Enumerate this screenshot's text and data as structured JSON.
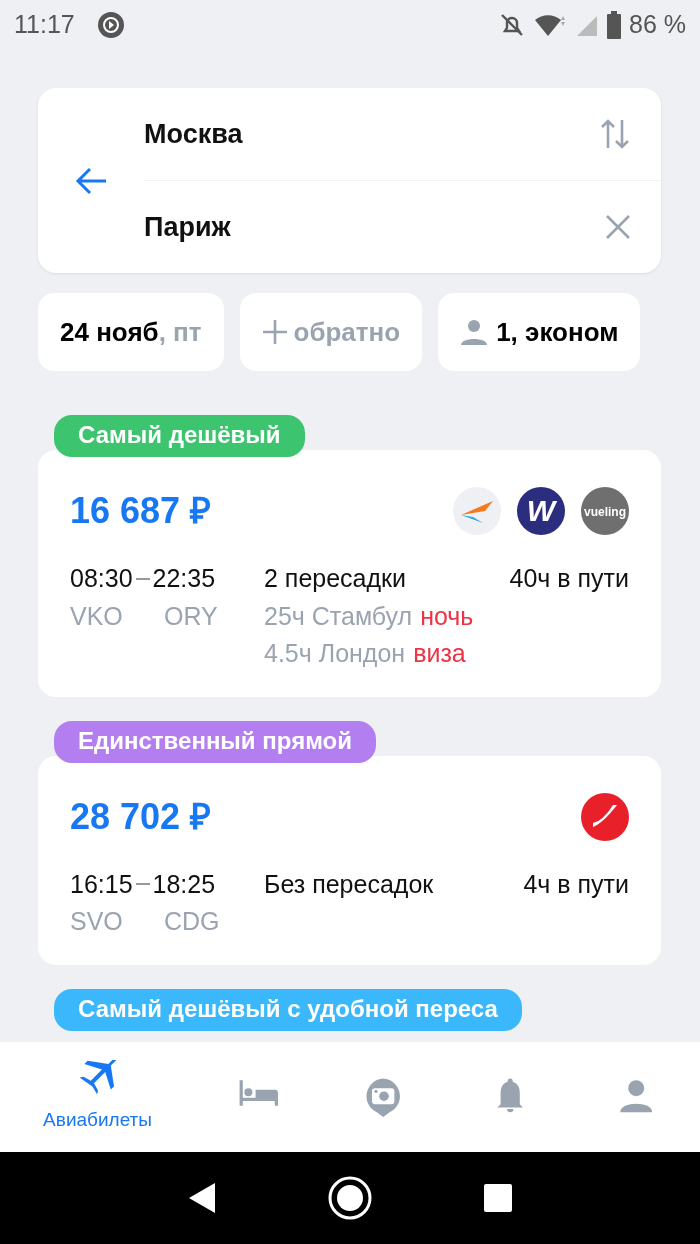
{
  "status_bar": {
    "time": "11:17",
    "battery": "86 %"
  },
  "search": {
    "from": "Москва",
    "to": "Париж"
  },
  "chips": [
    {
      "kind": "date",
      "text": "24 нояб",
      "suffix": ", пт"
    },
    {
      "kind": "return",
      "text": "обратно"
    },
    {
      "kind": "passengers",
      "text": "1, эконом"
    }
  ],
  "offers": [
    {
      "tag": "Самый дешёвый",
      "color": "#3cc46f",
      "price": "16 687 ₽",
      "logos": [
        {
          "kind": "swoosh"
        },
        {
          "kind": "letter",
          "text": "W"
        },
        {
          "kind": "word",
          "text": "vueling"
        }
      ],
      "depart": "08:30",
      "arrive": "22:35",
      "from_code": "VKO",
      "to_code": "ORY",
      "transfers": "2 пересадки",
      "duration": "40ч в пути",
      "stops": [
        {
          "text": "25ч Стамбул",
          "warning": "ночь"
        },
        {
          "text": "4.5ч Лондон",
          "warning": "виза"
        }
      ]
    },
    {
      "tag": "Единственный прямой",
      "color": "#b37ff0",
      "price": "28 702 ₽",
      "logos": [
        {
          "kind": "slash"
        }
      ],
      "depart": "16:15",
      "arrive": "18:25",
      "from_code": "SVO",
      "to_code": "CDG",
      "transfers": "Без пересадок",
      "duration": "4ч в пути"
    },
    {
      "tag": "Самый дешёвый с удобной переса",
      "color": "#3bb7fb"
    }
  ],
  "tabs": [
    {
      "kind": "flights",
      "label": "Авиабилеты",
      "selected": true
    },
    {
      "kind": "hotels",
      "selected": false
    },
    {
      "kind": "camera",
      "selected": false
    },
    {
      "kind": "bell",
      "selected": false
    },
    {
      "kind": "profile",
      "selected": false
    }
  ]
}
